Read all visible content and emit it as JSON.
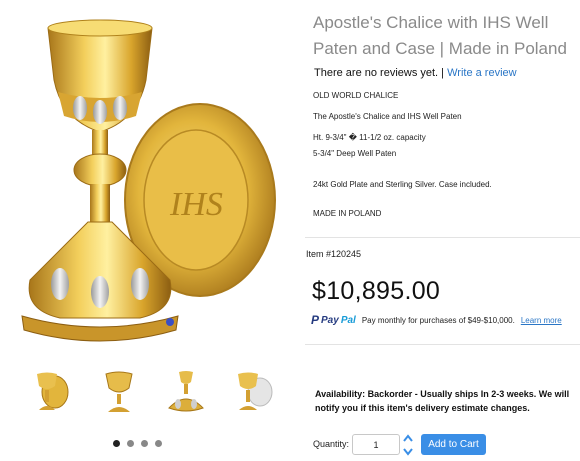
{
  "product": {
    "title": "Apostle's Chalice with IHS Well Paten and Case | Made in Poland",
    "reviews_text": "There are no reviews yet. |",
    "write_review_label": "Write a review",
    "line1": "OLD WORLD CHALICE",
    "line2": "The Apostle's Chalice and IHS Well Paten",
    "line3": "Ht. 9-3/4\" � 11-1/2 oz. capacity",
    "line4": "5-3/4\" Deep Well Paten",
    "line5": "24kt Gold Plate and Sterling Silver. Case included.",
    "line6": "MADE IN POLAND",
    "item_number": "Item #120245",
    "price": "$10,895.00"
  },
  "paypal": {
    "logo_pay": "Pay",
    "logo_pal": "Pal",
    "text": "Pay monthly for purchases of $49-$10,000.",
    "link": "Learn more"
  },
  "availability": "Availability: Backorder - Usually ships In 2-3 weeks. We will notify you if this item's delivery estimate changes.",
  "purchase": {
    "quantity_label": "Quantity:",
    "quantity_value": "1",
    "add_to_cart_label": "Add to Cart"
  },
  "gallery": {
    "thumb_count": 4,
    "slide_count": 4,
    "active_slide": 1
  },
  "colors": {
    "title_gray": "#8a8a8a",
    "link_blue": "#2a76c6",
    "button_blue": "#3a8ee6",
    "gold": "#d9ab2e"
  }
}
